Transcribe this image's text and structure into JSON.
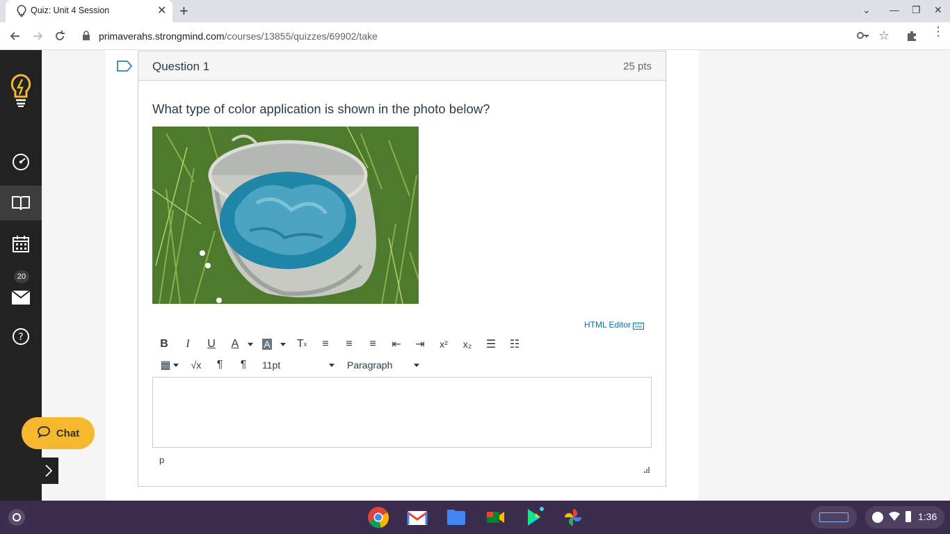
{
  "browser": {
    "tab_title": "Quiz: Unit 4 Session",
    "url_host": "primaverahs.strongmind.com",
    "url_path": "/courses/13855/quizzes/69902/take"
  },
  "rail": {
    "inbox_count": "20"
  },
  "question": {
    "title": "Question 1",
    "points": "25 pts",
    "text": "What type of color application is shown in the photo below?"
  },
  "editor": {
    "html_editor_label": "HTML Editor",
    "font_size": "11pt",
    "block_format": "Paragraph",
    "path": "p"
  },
  "chat": {
    "label": "Chat"
  },
  "shelf": {
    "time": "1:36"
  },
  "colors": {
    "rail_bg": "#222222",
    "chat_accent": "#f5b82e",
    "shelf_bg": "#3a2d4d",
    "link": "#0770a3"
  }
}
